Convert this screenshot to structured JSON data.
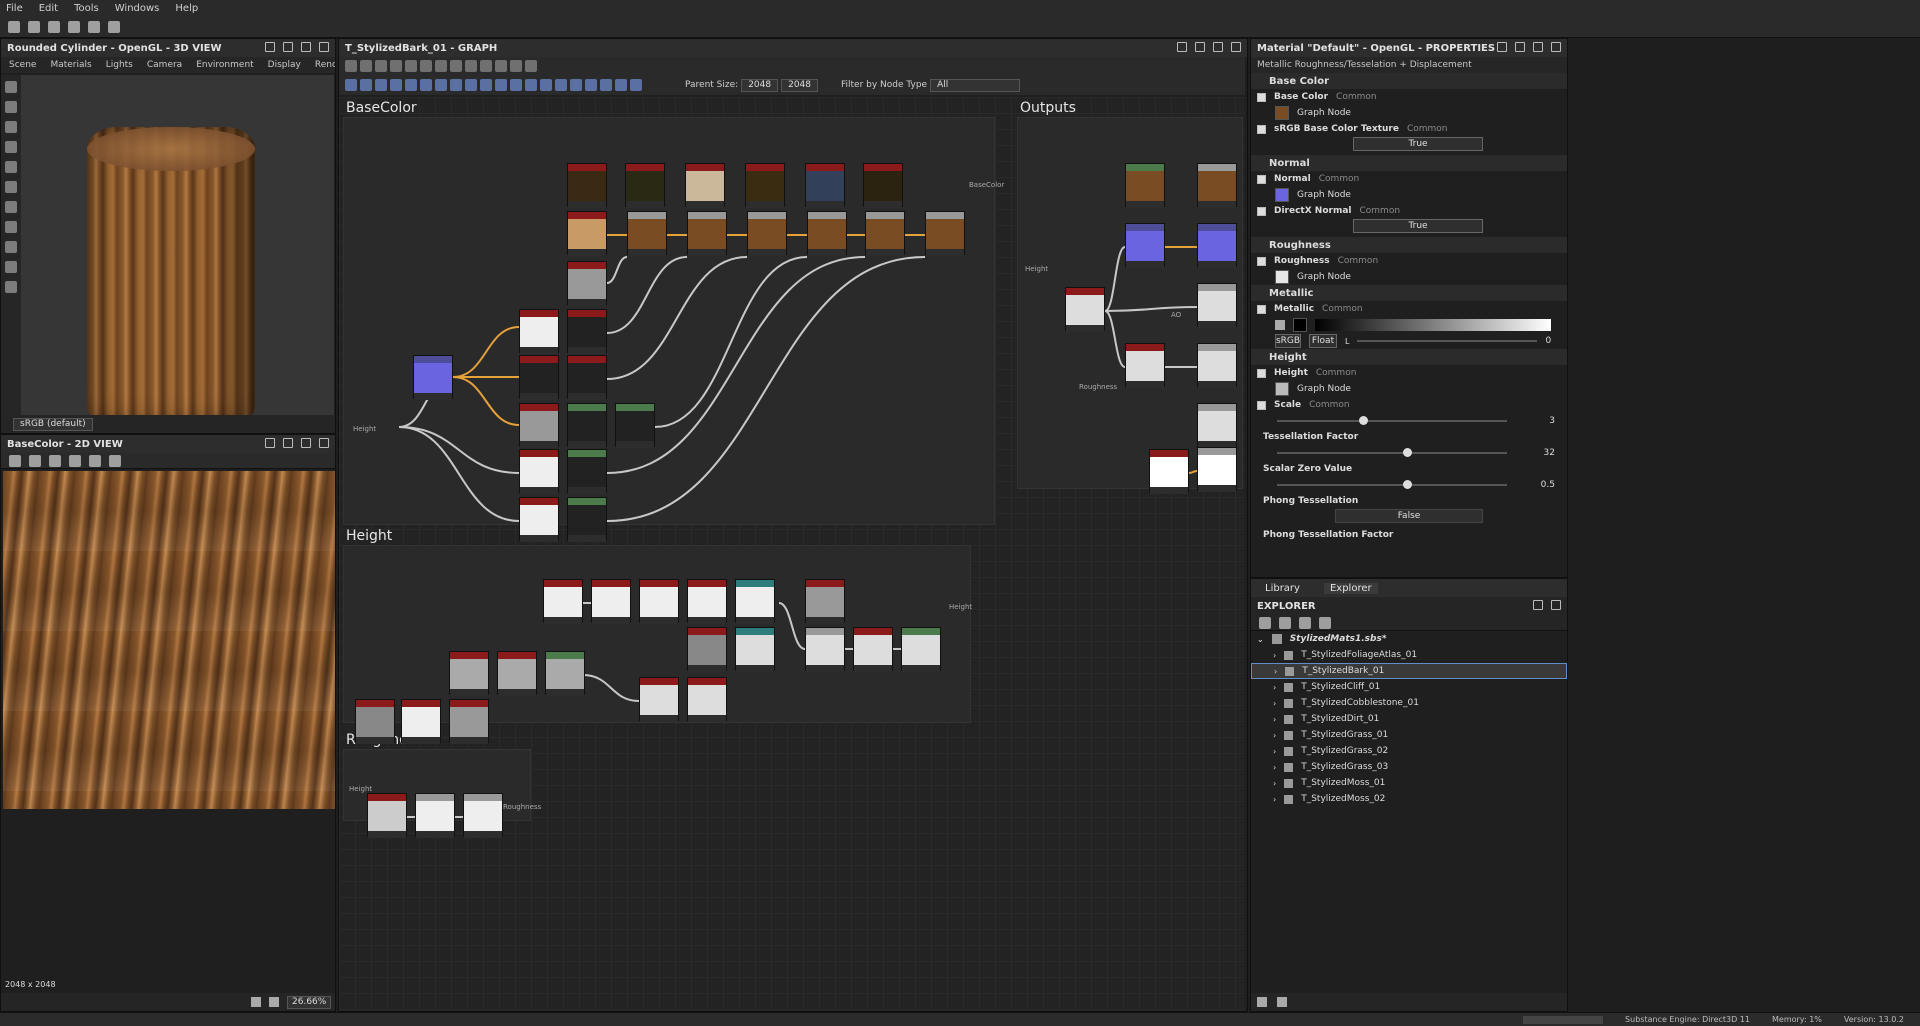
{
  "menu": [
    "File",
    "Edit",
    "Tools",
    "Windows",
    "Help"
  ],
  "view3d": {
    "title": "Rounded Cylinder - OpenGL - 3D VIEW",
    "submenu": [
      "Scene",
      "Materials",
      "Lights",
      "Camera",
      "Environment",
      "Display",
      "Renderer"
    ],
    "colorspace": "sRGB (default)"
  },
  "view2d": {
    "title": "BaseColor - 2D VIEW",
    "zoom": "26.66%",
    "overlay": "2048 x 2048"
  },
  "graph": {
    "title": "T_StylizedBark_01 - GRAPH",
    "parent_size_label": "Parent Size:",
    "parent_size": "2048",
    "parent_size2": "2048",
    "filter_label": "Filter by Node Type",
    "filter_value": "All",
    "frames": [
      "BaseColor",
      "Height",
      "Roughness",
      "Outputs"
    ],
    "labels": {
      "basecolor_out": "BaseColor",
      "height_in": "Height",
      "height_out": "Height",
      "roughness_in": "Height",
      "roughness_out": "Roughness",
      "outputs_height": "Height",
      "outputs_roughness": "Roughness",
      "outputs_ao": "AO"
    }
  },
  "properties": {
    "title": "Material \"Default\" - OpenGL - PROPERTIES",
    "subtitle": "Metallic Roughness/Tesselation + Displacement",
    "sections": {
      "base_color": "Base Color",
      "normal": "Normal",
      "roughness": "Roughness",
      "metallic": "Metallic",
      "height": "Height"
    },
    "rows": {
      "base_color_name": "Base Color",
      "srgb_name": "sRGB Base Color Texture",
      "normal_name": "Normal",
      "directx_name": "DirectX Normal",
      "roughness_name": "Roughness",
      "metallic_name": "Metallic",
      "height_name": "Height",
      "scale_name": "Scale"
    },
    "common": "Common",
    "graph_node": "Graph Node",
    "true": "True",
    "srgb_btn": "sRGB",
    "float_btn": "Float",
    "metallic_value": "0",
    "metallic_l": "L",
    "scale_value": "3",
    "tessellation": {
      "label": "Tessellation Factor",
      "value": "32"
    },
    "scalar_zero": {
      "label": "Scalar Zero Value",
      "value": "0.5"
    },
    "phong": {
      "label": "Phong Tessellation",
      "value": "False"
    },
    "phong_factor": {
      "label": "Phong Tessellation Factor"
    }
  },
  "explorer": {
    "tabs": [
      "Library",
      "Explorer"
    ],
    "title": "EXPLORER",
    "package": "StylizedMats1.sbs*",
    "items": [
      "T_StylizedFoliageAtlas_01",
      "T_StylizedBark_01",
      "T_StylizedCliff_01",
      "T_StylizedCobblestone_01",
      "T_StylizedDirt_01",
      "T_StylizedGrass_01",
      "T_StylizedGrass_02",
      "T_StylizedGrass_03",
      "T_StylizedMoss_01",
      "T_StylizedMoss_02"
    ],
    "selected": "T_StylizedBark_01"
  },
  "status": {
    "engine": "Substance Engine: Direct3D 11",
    "memory": "Memory: 1%",
    "version": "Version: 13.0.2"
  },
  "colors": {
    "accent": "#5f8fc6",
    "node_red": "#8b1b1b",
    "wire_orange": "#e5a13a"
  }
}
